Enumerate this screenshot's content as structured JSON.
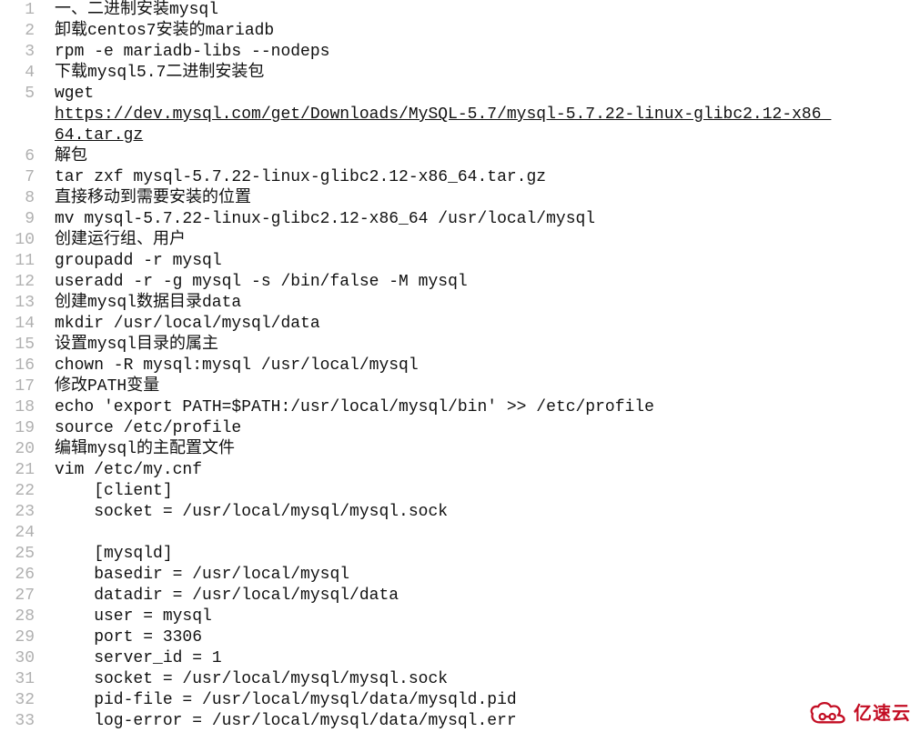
{
  "lines": [
    {
      "n": "1",
      "type": "text",
      "text": "一、二进制安装mysql"
    },
    {
      "n": "2",
      "type": "text",
      "text": "卸载centos7安装的mariadb"
    },
    {
      "n": "3",
      "type": "text",
      "text": "rpm -e mariadb-libs --nodeps"
    },
    {
      "n": "4",
      "type": "text",
      "text": "下载mysql5.7二进制安装包"
    },
    {
      "n": "5",
      "type": "wget",
      "prefix": "wget ",
      "url": "https://dev.mysql.com/get/Downloads/MySQL-5.7/mysql-5.7.22-linux-glibc2.12-x86_64.tar.gz",
      "url_part1": "https://dev.mysql.com/get/Downloads/MySQL-5.7/mysql-5.7.22-linux-glibc2.12-x86_",
      "url_part2": "64.tar.gz"
    },
    {
      "n": "6",
      "type": "text",
      "text": "解包"
    },
    {
      "n": "7",
      "type": "text",
      "text": "tar zxf mysql-5.7.22-linux-glibc2.12-x86_64.tar.gz"
    },
    {
      "n": "8",
      "type": "text",
      "text": "直接移动到需要安装的位置"
    },
    {
      "n": "9",
      "type": "text",
      "text": "mv mysql-5.7.22-linux-glibc2.12-x86_64 /usr/local/mysql"
    },
    {
      "n": "10",
      "type": "text",
      "text": "创建运行组、用户"
    },
    {
      "n": "11",
      "type": "text",
      "text": "groupadd -r mysql"
    },
    {
      "n": "12",
      "type": "text",
      "text": "useradd -r -g mysql -s /bin/false -M mysql"
    },
    {
      "n": "13",
      "type": "text",
      "text": "创建mysql数据目录data"
    },
    {
      "n": "14",
      "type": "text",
      "text": "mkdir /usr/local/mysql/data"
    },
    {
      "n": "15",
      "type": "text",
      "text": "设置mysql目录的属主"
    },
    {
      "n": "16",
      "type": "text",
      "text": "chown -R mysql:mysql /usr/local/mysql"
    },
    {
      "n": "17",
      "type": "text",
      "text": "修改PATH变量"
    },
    {
      "n": "18",
      "type": "text",
      "text": "echo 'export PATH=$PATH:/usr/local/mysql/bin' >> /etc/profile"
    },
    {
      "n": "19",
      "type": "text",
      "text": "source /etc/profile"
    },
    {
      "n": "20",
      "type": "text",
      "text": "编辑mysql的主配置文件"
    },
    {
      "n": "21",
      "type": "text",
      "text": "vim /etc/my.cnf"
    },
    {
      "n": "22",
      "type": "text",
      "text": "    [client]"
    },
    {
      "n": "23",
      "type": "text",
      "text": "    socket = /usr/local/mysql/mysql.sock"
    },
    {
      "n": "24",
      "type": "text",
      "text": ""
    },
    {
      "n": "25",
      "type": "text",
      "text": "    [mysqld]"
    },
    {
      "n": "26",
      "type": "text",
      "text": "    basedir = /usr/local/mysql"
    },
    {
      "n": "27",
      "type": "text",
      "text": "    datadir = /usr/local/mysql/data"
    },
    {
      "n": "28",
      "type": "text",
      "text": "    user = mysql"
    },
    {
      "n": "29",
      "type": "text",
      "text": "    port = 3306"
    },
    {
      "n": "30",
      "type": "text",
      "text": "    server_id = 1"
    },
    {
      "n": "31",
      "type": "text",
      "text": "    socket = /usr/local/mysql/mysql.sock"
    },
    {
      "n": "32",
      "type": "text",
      "text": "    pid-file = /usr/local/mysql/data/mysqld.pid"
    },
    {
      "n": "33",
      "type": "text",
      "text": "    log-error = /usr/local/mysql/data/mysql.err"
    }
  ],
  "watermark_text": "亿速云"
}
